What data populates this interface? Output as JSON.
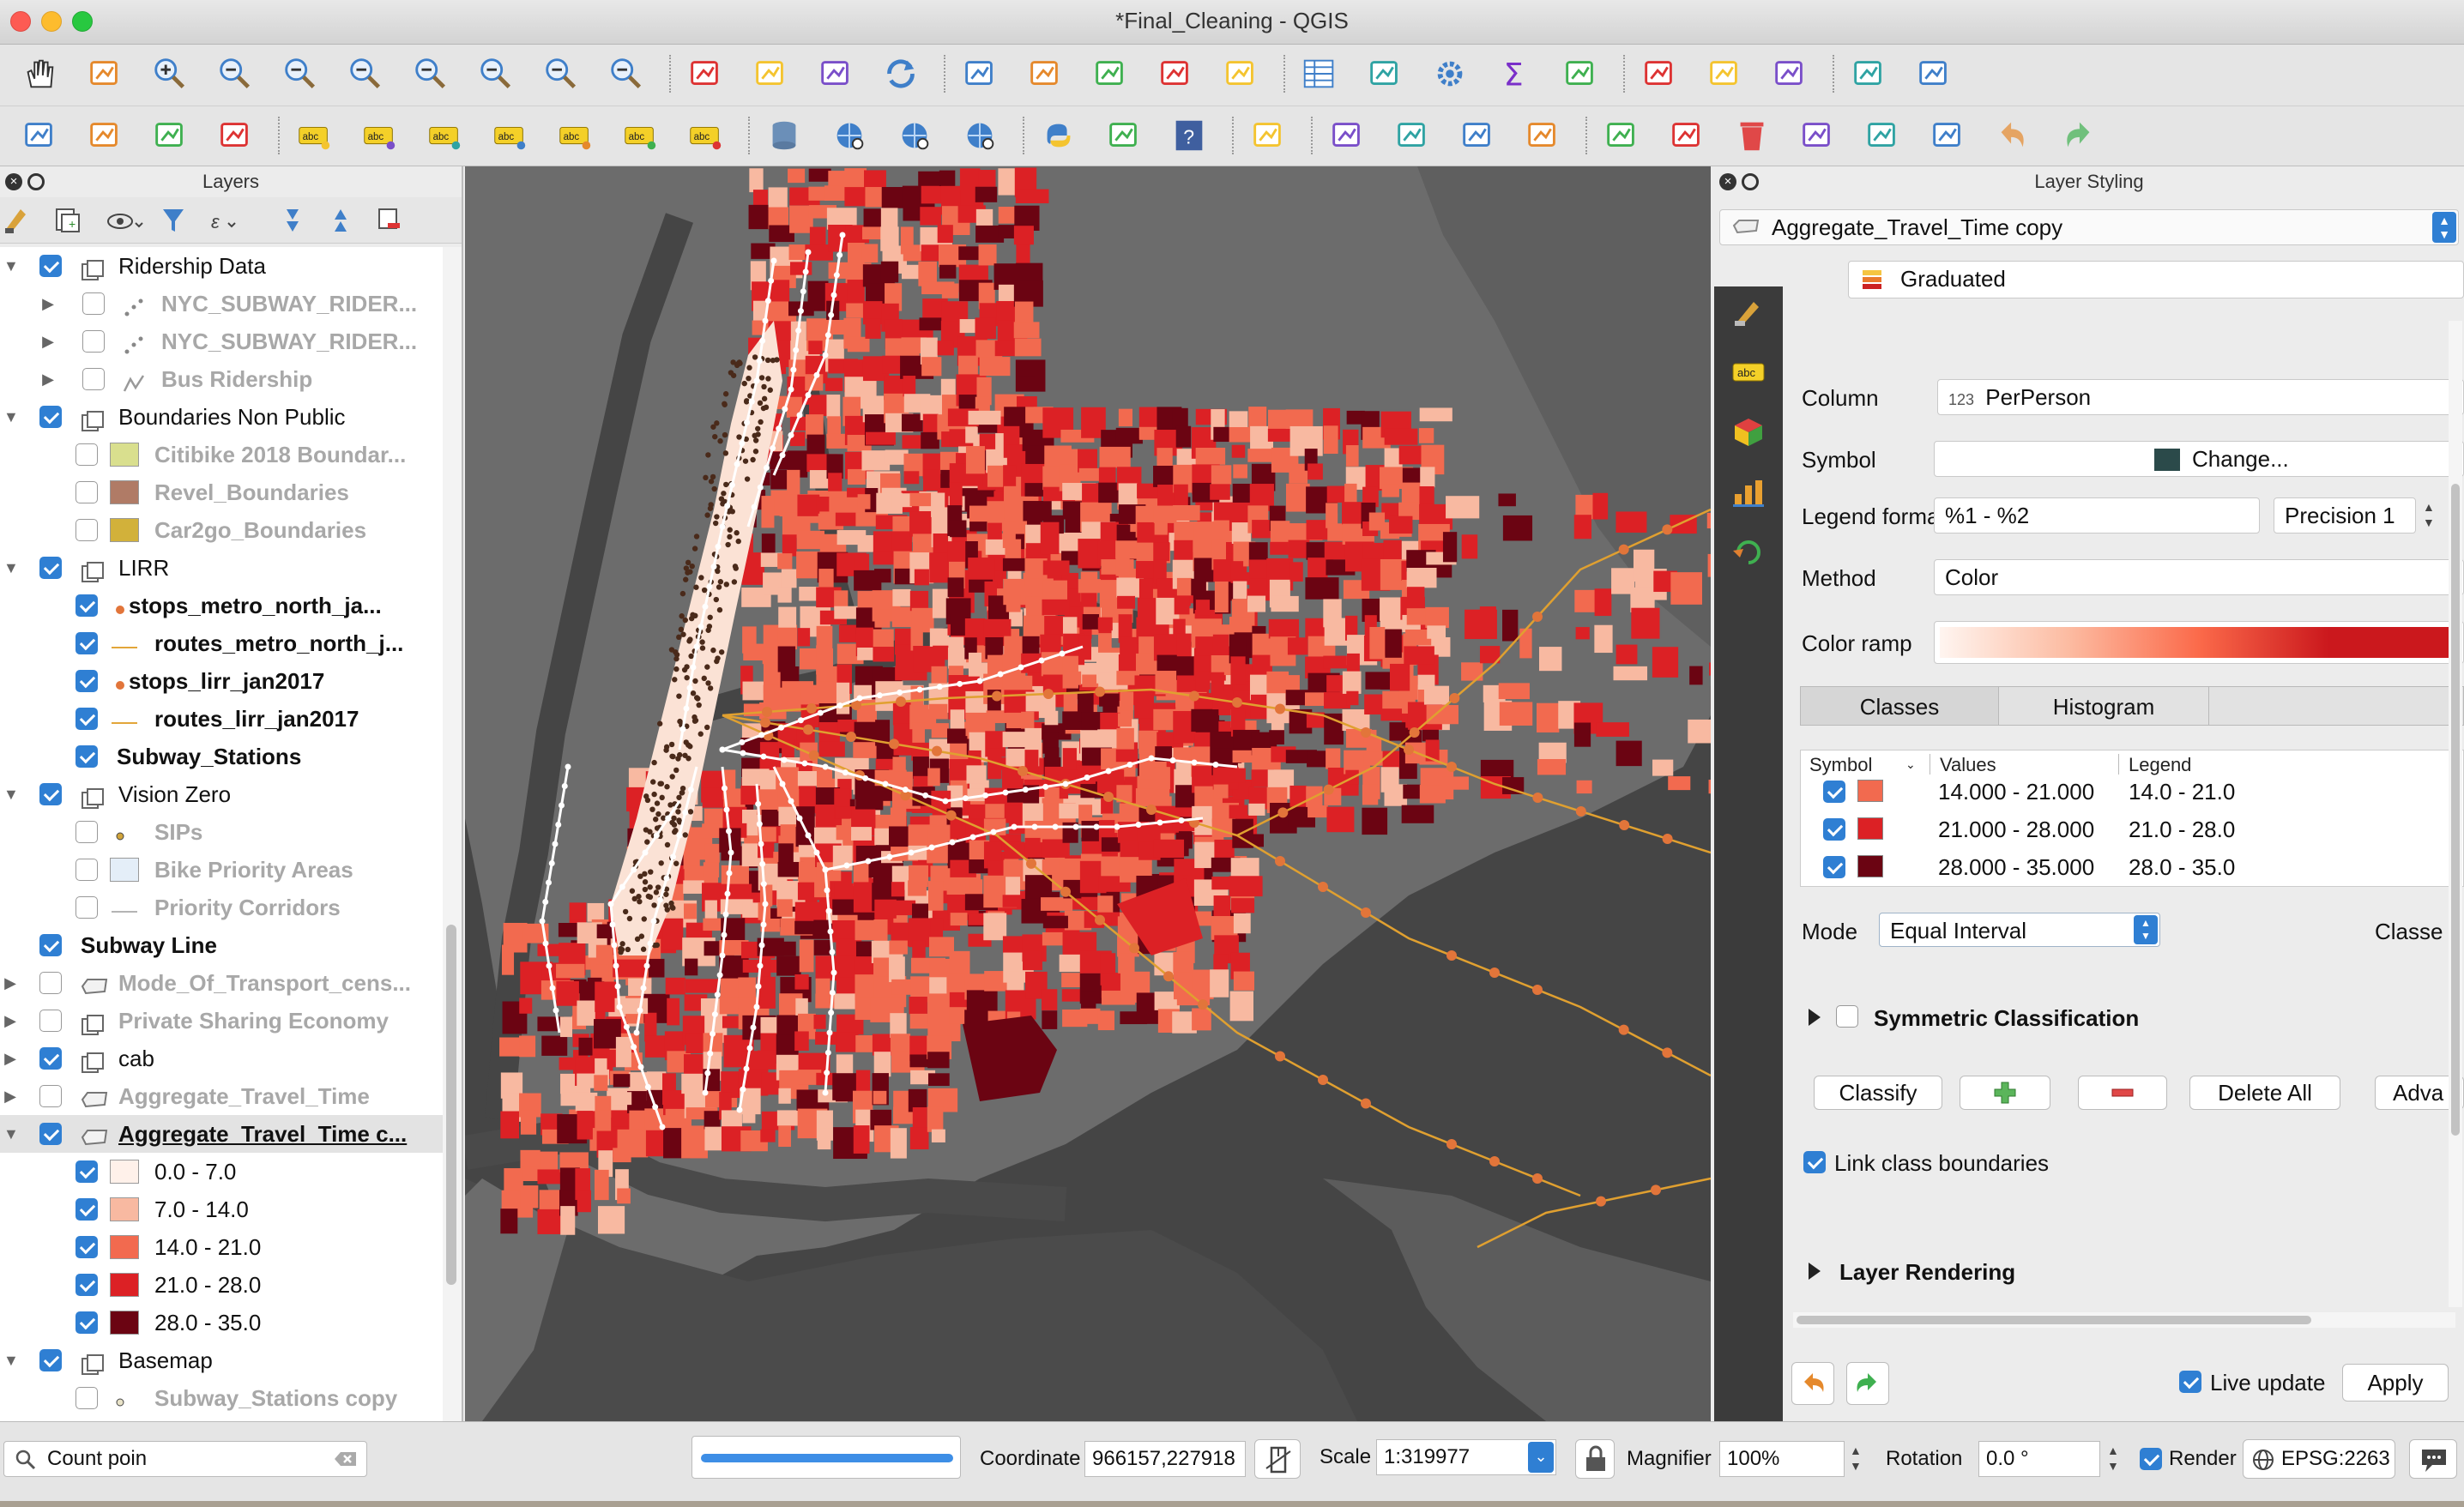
{
  "window": {
    "title": "*Final_Cleaning - QGIS"
  },
  "icons_toolbar1": [
    "pan-hand-icon",
    "pan-to-selection-icon",
    "zoom-in-icon",
    "zoom-out-icon",
    "zoom-native-icon",
    "zoom-full-icon",
    "zoom-to-selection-icon",
    "zoom-to-layer-icon",
    "zoom-last-icon",
    "zoom-next-icon",
    "new-bookmark-icon",
    "show-bookmarks-icon",
    "spatial-bookmark-icon",
    "refresh-icon",
    "identify-icon",
    "action-icon",
    "select-features-icon",
    "select-by-value-icon",
    "deselect-icon",
    "attribute-table-icon",
    "field-calculator-icon",
    "processing-gear-icon",
    "statistics-sigma-icon",
    "measure-icon",
    "map-tips-icon",
    "text-annotation-icon",
    "profile-icon",
    "plugin-icon",
    "plugin2-icon"
  ],
  "icons_toolbar2": [
    "add-feature-icon",
    "vertex-tool-icon",
    "digitize-icon",
    "trace-icon",
    "label-abc-icon",
    "move-label-icon",
    "pin-label-icon",
    "show-hide-label-icon",
    "rotate-label-icon",
    "change-label-icon",
    "label-toolbar-icon",
    "data-source-manager-icon",
    "metasearch-icon",
    "globe-search-icon",
    "identify-globe-icon",
    "python-icon",
    "map-layer-icon",
    "help-icon",
    "web-icon",
    "edit-pencil-icon",
    "toggle-editing-icon",
    "save-edits-icon",
    "digitize-polygon-icon",
    "vertex-edit-icon",
    "modify-attributes-icon",
    "delete-selected-icon",
    "cut-icon",
    "copy-icon",
    "paste-icon",
    "undo-icon",
    "redo-icon"
  ],
  "layers_panel": {
    "title": "Layers",
    "tree": [
      {
        "label": "Ridership Data",
        "type": "group",
        "checked": true,
        "style": "normal"
      },
      {
        "label": "NYC_SUBWAY_RIDER...",
        "type": "point-layer",
        "checked": false,
        "style": "dim"
      },
      {
        "label": "NYC_SUBWAY_RIDER...",
        "type": "point-layer",
        "checked": false,
        "style": "dim"
      },
      {
        "label": "Bus Ridership",
        "type": "line-layer",
        "checked": false,
        "style": "dim"
      },
      {
        "label": "Boundaries Non Public",
        "type": "group",
        "checked": true,
        "style": "normal"
      },
      {
        "label": "Citibike 2018 Boundar...",
        "type": "polygon",
        "checked": false,
        "style": "dim",
        "color": "#d9df8e"
      },
      {
        "label": "Revel_Boundaries",
        "type": "polygon",
        "checked": false,
        "style": "dim",
        "color": "#b07b66"
      },
      {
        "label": "Car2go_Boundaries",
        "type": "polygon",
        "checked": false,
        "style": "dim",
        "color": "#d2b13a"
      },
      {
        "label": "LIRR",
        "type": "group",
        "checked": true,
        "style": "normal"
      },
      {
        "label": "stops_metro_north_ja...",
        "type": "dot",
        "checked": true,
        "style": "bold",
        "color": "#e2753a"
      },
      {
        "label": "routes_metro_north_j...",
        "type": "line",
        "checked": true,
        "style": "bold",
        "color": "#e2a63a"
      },
      {
        "label": "stops_lirr_jan2017",
        "type": "dot",
        "checked": true,
        "style": "bold",
        "color": "#e2753a"
      },
      {
        "label": "routes_lirr_jan2017",
        "type": "line",
        "checked": true,
        "style": "bold",
        "color": "#e2a63a"
      },
      {
        "label": "Subway_Stations",
        "type": "none",
        "checked": true,
        "style": "bold"
      },
      {
        "label": "Vision Zero",
        "type": "group",
        "checked": true,
        "style": "normal"
      },
      {
        "label": "SIPs",
        "type": "dot-small",
        "checked": false,
        "style": "dim",
        "color": "#d1a43a"
      },
      {
        "label": "Bike Priority Areas",
        "type": "polygon",
        "checked": false,
        "style": "dim",
        "color": "#e4eef8"
      },
      {
        "label": "Priority Corridors",
        "type": "line",
        "checked": false,
        "style": "dim",
        "color": "#b4b4b4"
      },
      {
        "label": "Subway Line",
        "type": "none",
        "checked": true,
        "style": "bold"
      },
      {
        "label": "Mode_Of_Transport_cens...",
        "type": "polygon-layer",
        "checked": false,
        "style": "dim"
      },
      {
        "label": "Private Sharing Economy",
        "type": "group",
        "checked": false,
        "style": "dim"
      },
      {
        "label": "cab",
        "type": "group",
        "checked": true,
        "style": "normal"
      },
      {
        "label": "Aggregate_Travel_Time",
        "type": "polygon-layer",
        "checked": false,
        "style": "dim"
      },
      {
        "label": "Aggregate_Travel_Time c...",
        "type": "polygon-layer",
        "checked": true,
        "style": "selected"
      },
      {
        "label": "0.0 - 7.0",
        "type": "class",
        "checked": true,
        "style": "normal",
        "color": "#fff1ea"
      },
      {
        "label": "7.0 - 14.0",
        "type": "class",
        "checked": true,
        "style": "normal",
        "color": "#f8b9a1"
      },
      {
        "label": "14.0 - 21.0",
        "type": "class",
        "checked": true,
        "style": "normal",
        "color": "#f26a4f"
      },
      {
        "label": "21.0 - 28.0",
        "type": "class",
        "checked": true,
        "style": "normal",
        "color": "#dc2125"
      },
      {
        "label": "28.0 - 35.0",
        "type": "class",
        "checked": true,
        "style": "normal",
        "color": "#6b0412"
      },
      {
        "label": "Basemap",
        "type": "group",
        "checked": true,
        "style": "normal"
      },
      {
        "label": "Subway_Stations copy",
        "type": "dot-small",
        "checked": false,
        "style": "dim",
        "color": "#e9e3c8"
      }
    ]
  },
  "styling_panel": {
    "title": "Layer Styling",
    "layer_select": "Aggregate_Travel_Time copy",
    "renderer": "Graduated",
    "column_label": "Column",
    "column_type": "123",
    "column_value": "PerPerson",
    "symbol_label": "Symbol",
    "symbol_change": "Change...",
    "symbol_color": "#2b4a4a",
    "legend_format_label": "Legend format",
    "legend_format_value": "%1 - %2",
    "precision_label": "Precision 1",
    "method_label": "Method",
    "method_value": "Color",
    "color_ramp_label": "Color ramp",
    "tabs": [
      "Classes",
      "Histogram"
    ],
    "table_headers": {
      "symbol": "Symbol",
      "values": "Values",
      "legend": "Legend"
    },
    "classes": [
      {
        "values": "14.000 - 21.000",
        "legend": "14.0 - 21.0",
        "color": "#f26a4f"
      },
      {
        "values": "21.000 - 28.000",
        "legend": "21.0 - 28.0",
        "color": "#dc2125"
      },
      {
        "values": "28.000 - 35.000",
        "legend": "28.0 - 35.0",
        "color": "#6b0412"
      }
    ],
    "mode_label": "Mode",
    "mode_value": "Equal Interval",
    "classes_label": "Classe",
    "symmetric_label": "Symmetric Classification",
    "classify_button": "Classify",
    "delete_all_button": "Delete All",
    "advanced_button": "Adva",
    "link_boundaries_label": "Link class boundaries",
    "layer_rendering_label": "Layer Rendering",
    "live_update_label": "Live update",
    "apply_button": "Apply"
  },
  "status_bar": {
    "search_value": "Count poin",
    "progress": 1.0,
    "coordinate_label": "Coordinate",
    "coordinate_value": "966157,227918",
    "scale_label": "Scale",
    "scale_value": "1:319977",
    "magnifier_label": "Magnifier",
    "magnifier_value": "100%",
    "rotation_label": "Rotation",
    "rotation_value": "0.0 °",
    "render_label": "Render",
    "crs_value": "EPSG:2263"
  },
  "colors": {
    "accent": "#2f7fd3",
    "map_background": "#454545",
    "land": "#6e6e6e",
    "water": "#454545",
    "class_0": "#fff1ea",
    "class_1": "#f8b9a1",
    "class_2": "#f26a4f",
    "class_3": "#dc2125",
    "class_4": "#6b0412",
    "rail_line": "#e0a030",
    "rail_stop": "#e2753a",
    "subway": "#ffffff"
  }
}
